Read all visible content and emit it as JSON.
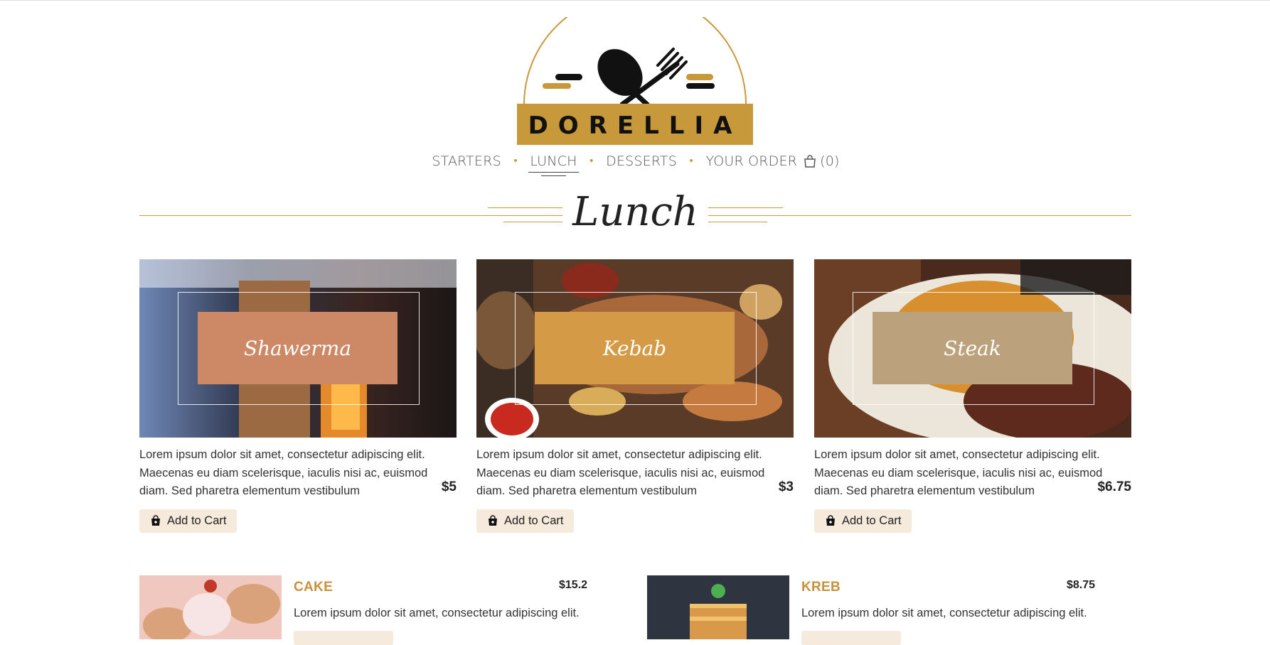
{
  "brand": {
    "name": "DORELLIA"
  },
  "colors": {
    "gold": "#c8993a",
    "accent_dot": "#c89a3a",
    "button_bg": "#f6eadd"
  },
  "nav": {
    "items": [
      {
        "label": "STARTERS"
      },
      {
        "label": "LUNCH",
        "active": true
      },
      {
        "label": "DESSERTS"
      },
      {
        "label": "YOUR ORDER"
      }
    ],
    "cart_count": "(0)",
    "separator": "•"
  },
  "section": {
    "title": "Lunch"
  },
  "cards": [
    {
      "name": "Shawerma",
      "desc": "Lorem ipsum dolor sit amet, consectetur adipiscing elit. Maecenas eu diam scelerisque, iaculis nisi ac, euismod diam. Sed pharetra elementum vestibulum",
      "price": "$5",
      "button": "Add to Cart",
      "box_color": "#cd8866"
    },
    {
      "name": "Kebab",
      "desc": "Lorem ipsum dolor sit amet, consectetur adipiscing elit. Maecenas eu diam scelerisque, iaculis nisi ac, euismod diam. Sed pharetra elementum vestibulum",
      "price": "$3",
      "button": "Add to Cart",
      "box_color": "#d49a45"
    },
    {
      "name": "Steak",
      "desc": "Lorem ipsum dolor sit amet, consectetur adipiscing elit. Maecenas eu diam scelerisque, iaculis nisi ac, euismod diam. Sed pharetra elementum vestibulum",
      "price": "$6.75",
      "button": "Add to Cart",
      "box_color": "#bca27c"
    }
  ],
  "small_items": [
    {
      "title": "CAKE",
      "price": "$15.2",
      "desc": "Lorem ipsum dolor sit amet, consectetur adipiscing elit."
    },
    {
      "title": "KREB",
      "price": "$8.75",
      "desc": "Lorem ipsum dolor sit amet, consectetur adipiscing elit."
    }
  ]
}
